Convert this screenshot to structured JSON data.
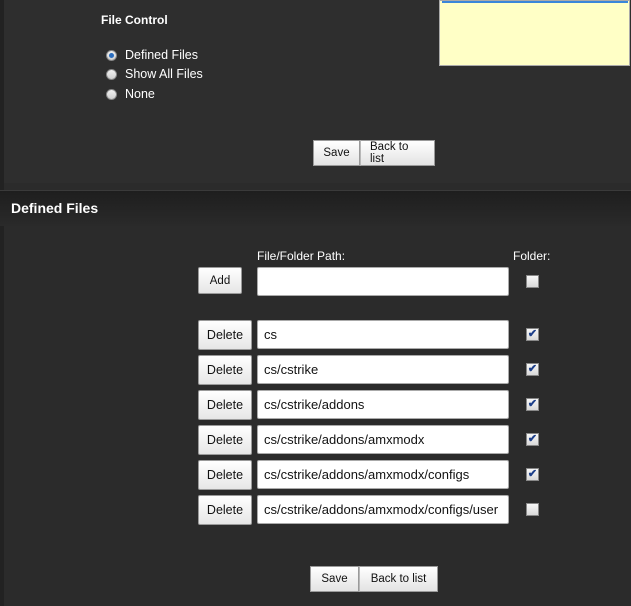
{
  "file_control": {
    "title": "File Control",
    "options": [
      {
        "label": "Defined Files",
        "checked": true
      },
      {
        "label": "Show All Files",
        "checked": false
      },
      {
        "label": "None",
        "checked": false
      }
    ],
    "save_label": "Save",
    "back_label": "Back to list"
  },
  "defined_files": {
    "title": "Defined Files",
    "path_column_label": "File/Folder Path:",
    "folder_column_label": "Folder:",
    "add_label": "Add",
    "new_path_value": "",
    "new_folder_checked": false,
    "delete_label": "Delete",
    "rows": [
      {
        "path": "cs",
        "folder": true
      },
      {
        "path": "cs/cstrike",
        "folder": true
      },
      {
        "path": "cs/cstrike/addons",
        "folder": true
      },
      {
        "path": "cs/cstrike/addons/amxmodx",
        "folder": true
      },
      {
        "path": "cs/cstrike/addons/amxmodx/configs",
        "folder": true
      },
      {
        "path": "cs/cstrike/addons/amxmodx/configs/user",
        "folder": false
      }
    ],
    "save_label": "Save",
    "back_label": "Back to list"
  },
  "check_glyph": "✔"
}
